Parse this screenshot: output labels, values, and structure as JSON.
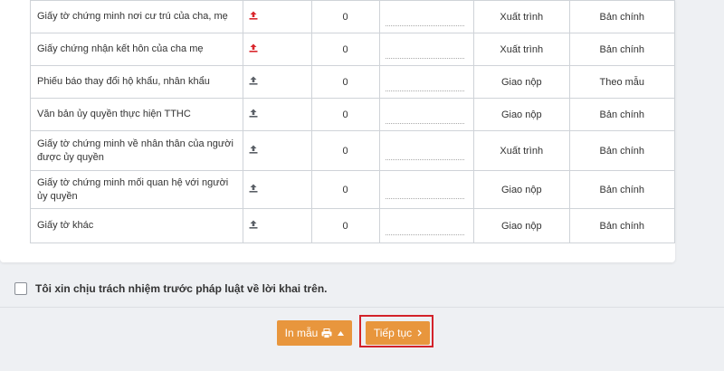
{
  "table": {
    "rows": [
      {
        "name": "Giấy tờ chứng minh nơi cư trú của cha, mẹ",
        "icon": "upload-icon-red",
        "count": "0",
        "type": "Xuất trình",
        "form": "Bản chính"
      },
      {
        "name": "Giấy chứng nhận kết hôn của cha mẹ",
        "icon": "upload-icon-red",
        "count": "0",
        "type": "Xuất trình",
        "form": "Bản chính"
      },
      {
        "name": "Phiếu báo thay đổi hộ khẩu, nhân khẩu",
        "icon": "upload-icon",
        "count": "0",
        "type": "Giao nộp",
        "form": "Theo mẫu"
      },
      {
        "name": "Văn bản ủy quyền thực hiện TTHC",
        "icon": "upload-icon",
        "count": "0",
        "type": "Giao nộp",
        "form": "Bản chính"
      },
      {
        "name": "Giấy tờ chứng minh về nhân thân của người được ủy quyền",
        "icon": "upload-icon",
        "count": "0",
        "type": "Xuất trình",
        "form": "Bản chính"
      },
      {
        "name": "Giấy tờ chứng minh mối quan hệ với người ủy quyền",
        "icon": "upload-icon",
        "count": "0",
        "type": "Giao nộp",
        "form": "Bản chính"
      },
      {
        "name": "Giấy tờ khác",
        "icon": "upload-icon",
        "count": "0",
        "type": "Giao nộp",
        "form": "Bản chính"
      }
    ]
  },
  "declaration": {
    "label": "Tôi xin chịu trách nhiệm trước pháp luật về lời khai trên.",
    "checked": false
  },
  "actions": {
    "print_label": "In mẫu",
    "next_label": "Tiếp tục"
  },
  "colors": {
    "accent": "#e8963d",
    "highlight": "#d3222a",
    "upload_red": "#d9262c",
    "upload_gray": "#5a5f66"
  }
}
